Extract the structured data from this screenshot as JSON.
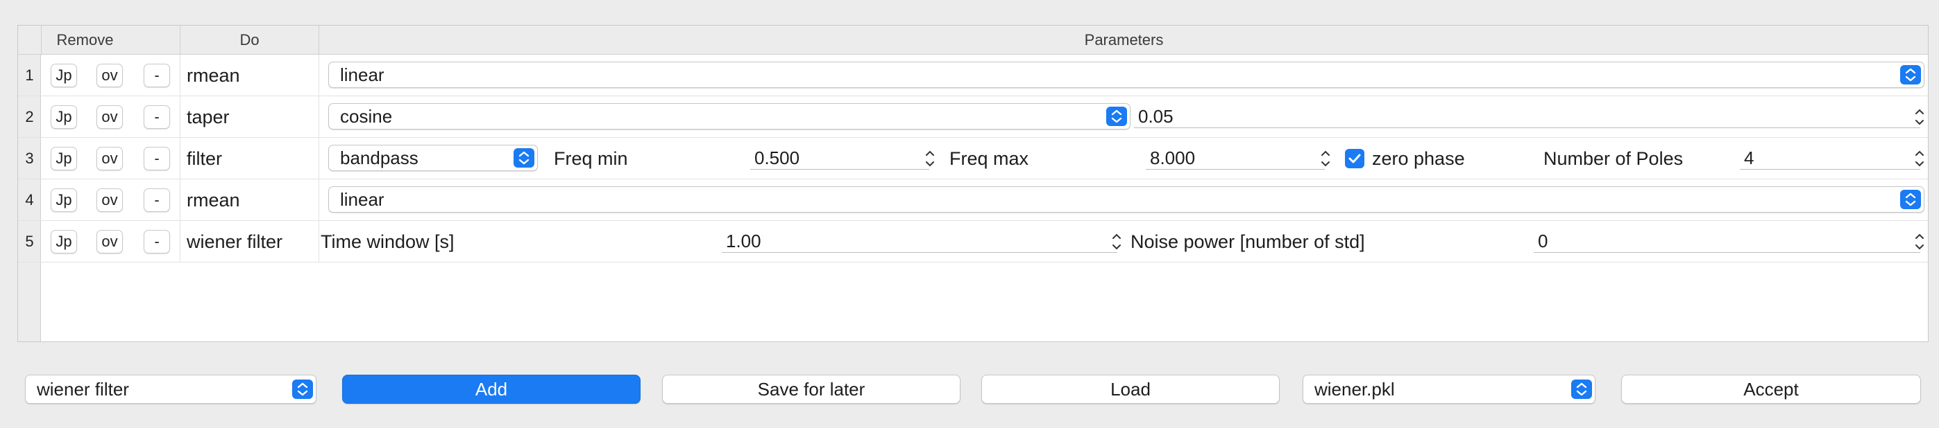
{
  "table": {
    "headers": {
      "remove": "Remove",
      "do": "Do",
      "parameters": "Parameters"
    },
    "row_controls": {
      "up_label": "Jp",
      "down_label": "ov",
      "minus_label": "-"
    },
    "rows": [
      {
        "num": "1",
        "do": "rmean",
        "method": "linear"
      },
      {
        "num": "2",
        "do": "taper",
        "type": "cosine",
        "value": "0.05"
      },
      {
        "num": "3",
        "do": "filter",
        "type": "bandpass",
        "freq_min_label": "Freq min",
        "freq_min": "0.500",
        "freq_max_label": "Freq max",
        "freq_max": "8.000",
        "zero_phase_label": "zero phase",
        "zero_phase_checked": true,
        "poles_label": "Number of Poles",
        "poles": "4"
      },
      {
        "num": "4",
        "do": "rmean",
        "method": "linear"
      },
      {
        "num": "5",
        "do": "wiener filter",
        "time_window_label": "Time window [s]",
        "time_window": "1.00",
        "noise_power_label": "Noise power [number of std]",
        "noise_power": "0"
      }
    ]
  },
  "bottom": {
    "operation_select": "wiener filter",
    "add_label": "Add",
    "save_label": "Save for later",
    "load_label": "Load",
    "file_select": "wiener.pkl",
    "accept_label": "Accept"
  },
  "icons": {
    "combo_arrow": "updown-chevron-icon",
    "stepper": "spin-stepper-icon",
    "check": "checkmark-icon"
  },
  "colors": {
    "accent": "#1a7bf2",
    "background": "#ececec"
  }
}
